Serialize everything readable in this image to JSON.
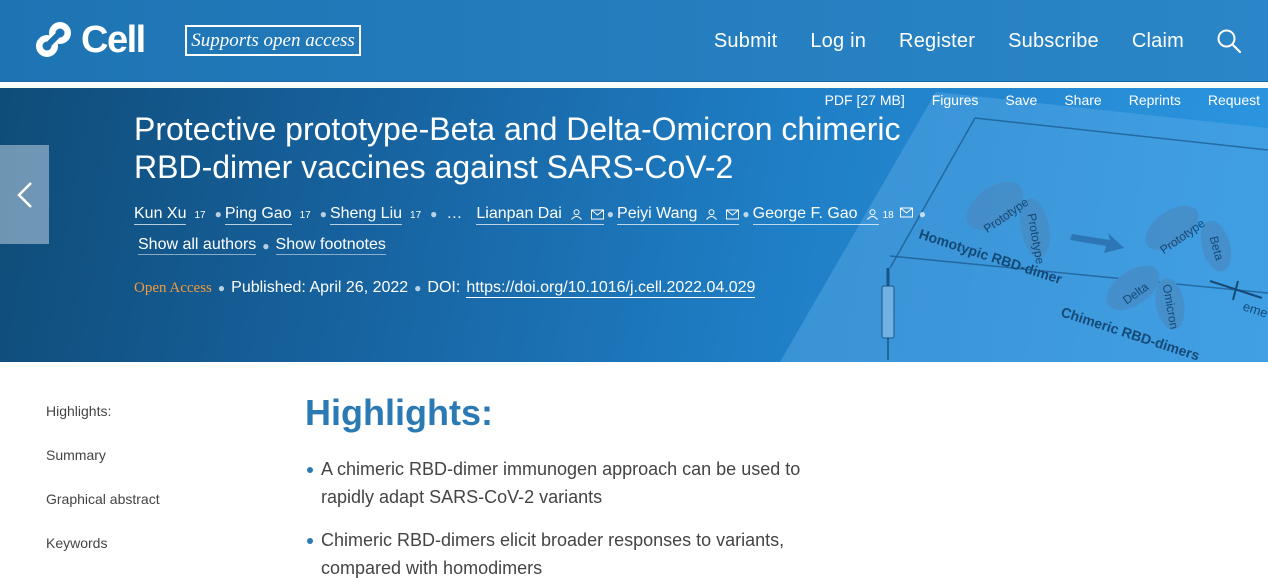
{
  "header": {
    "logo_text": "Cell",
    "badge": "Supports open access",
    "nav": [
      "Submit",
      "Log in",
      "Register",
      "Subscribe",
      "Claim"
    ],
    "brand_color": "#1e74b3"
  },
  "toolbar": {
    "items": [
      "PDF [27 MB]",
      "Figures",
      "Save",
      "Share",
      "Reprints",
      "Request"
    ]
  },
  "article": {
    "title": "Protective prototype-Beta and Delta-Omicron chimeric RBD-dimer vaccines against SARS-CoV-2",
    "authors": [
      {
        "name": "Kun Xu",
        "sup": "17"
      },
      {
        "name": "Ping Gao",
        "sup": "17"
      },
      {
        "name": "Sheng Liu",
        "sup": "17"
      },
      {
        "name": "Lianpan Dai",
        "sup": ""
      },
      {
        "name": "Peiyi Wang",
        "sup": ""
      },
      {
        "name": "George F. Gao",
        "sup": "18"
      }
    ],
    "ellipsis": "…",
    "show_all_authors": "Show all authors",
    "show_footnotes": "Show footnotes",
    "open_access": "Open Access",
    "published": "Published: April 26, 2022",
    "doi_label": "DOI:",
    "doi_url": "https://doi.org/10.1016/j.cell.2022.04.029",
    "open_access_color": "#f39a3c"
  },
  "figure_text": {
    "homotypic": "Homotypic RBD-dimer",
    "chimeric": "Chimeric RBD-dimers",
    "prototype": "Prototype",
    "beta": "Beta",
    "delta": "Delta",
    "omicron": "Omicron",
    "emerging": "eme"
  },
  "sidebar": {
    "items": [
      "Highlights:",
      "Summary",
      "Graphical abstract",
      "Keywords"
    ]
  },
  "highlights": {
    "title": "Highlights:",
    "items": [
      "A chimeric RBD-dimer immunogen approach can be used to rapidly adapt SARS-CoV-2 variants",
      "Chimeric RBD-dimers elicit broader responses to variants, compared with homodimers"
    ]
  }
}
